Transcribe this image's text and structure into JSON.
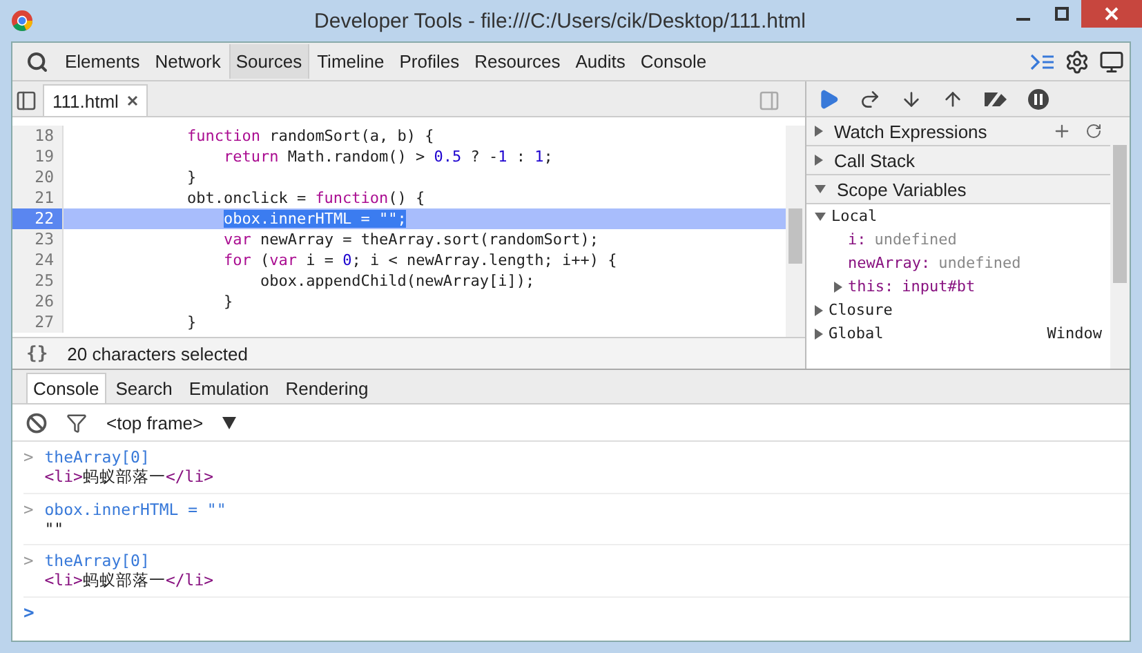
{
  "window": {
    "title": "Developer Tools - file:///C:/Users/cik/Desktop/111.html"
  },
  "panels": [
    {
      "label": "Elements",
      "selected": false
    },
    {
      "label": "Network",
      "selected": false
    },
    {
      "label": "Sources",
      "selected": true
    },
    {
      "label": "Timeline",
      "selected": false
    },
    {
      "label": "Profiles",
      "selected": false
    },
    {
      "label": "Resources",
      "selected": false
    },
    {
      "label": "Audits",
      "selected": false
    },
    {
      "label": "Console",
      "selected": false
    }
  ],
  "editor": {
    "file_tab": "111.html",
    "lines": [
      {
        "number": "18",
        "current": false,
        "tokens": [
          {
            "text": "            function",
            "kind": "keyword"
          },
          {
            "text": " randomSort(a, b) {",
            "kind": "plain"
          }
        ]
      },
      {
        "number": "19",
        "current": false,
        "tokens": [
          {
            "text": "                return",
            "kind": "keyword"
          },
          {
            "text": " Math.random() > ",
            "kind": "plain"
          },
          {
            "text": "0.5",
            "kind": "number"
          },
          {
            "text": " ? -",
            "kind": "plain"
          },
          {
            "text": "1",
            "kind": "number"
          },
          {
            "text": " : ",
            "kind": "plain"
          },
          {
            "text": "1",
            "kind": "number"
          },
          {
            "text": ";",
            "kind": "plain"
          }
        ]
      },
      {
        "number": "20",
        "current": false,
        "tokens": [
          {
            "text": "            }",
            "kind": "plain"
          }
        ]
      },
      {
        "number": "21",
        "current": false,
        "tokens": [
          {
            "text": "            obt.onclick = ",
            "kind": "plain"
          },
          {
            "text": "function",
            "kind": "keyword"
          },
          {
            "text": "() {",
            "kind": "plain"
          }
        ]
      },
      {
        "number": "22",
        "current": true,
        "tokens": [
          {
            "text": "                obox.innerHTML = \"\";",
            "kind": "selection"
          }
        ]
      },
      {
        "number": "23",
        "current": false,
        "tokens": [
          {
            "text": "                var",
            "kind": "keyword"
          },
          {
            "text": " newArray = theArray.sort(randomSort);",
            "kind": "plain"
          }
        ]
      },
      {
        "number": "24",
        "current": false,
        "tokens": [
          {
            "text": "                for",
            "kind": "keyword"
          },
          {
            "text": " (",
            "kind": "plain"
          },
          {
            "text": "var",
            "kind": "keyword"
          },
          {
            "text": " i = ",
            "kind": "plain"
          },
          {
            "text": "0",
            "kind": "number"
          },
          {
            "text": "; i < newArray.length; i++) {",
            "kind": "plain"
          }
        ]
      },
      {
        "number": "25",
        "current": false,
        "tokens": [
          {
            "text": "                    obox.appendChild(newArray[i]);",
            "kind": "plain"
          }
        ]
      },
      {
        "number": "26",
        "current": false,
        "tokens": [
          {
            "text": "                }",
            "kind": "plain"
          }
        ]
      },
      {
        "number": "27",
        "current": false,
        "tokens": [
          {
            "text": "            }",
            "kind": "plain"
          }
        ]
      }
    ],
    "status": "20 characters selected",
    "format_button": "{}"
  },
  "sidebar": {
    "sections": [
      {
        "label": "Watch Expressions",
        "expanded": false
      },
      {
        "label": "Call Stack",
        "expanded": false
      },
      {
        "label": "Scope Variables",
        "expanded": true
      }
    ],
    "scopes": [
      {
        "label": "Local",
        "expanded": true,
        "children": [
          {
            "name": "i",
            "separator": ":",
            "value": "undefined",
            "kind": "undefined",
            "expandable": false
          },
          {
            "name": "newArray",
            "separator": ":",
            "value": "undefined",
            "kind": "undefined",
            "expandable": false
          },
          {
            "name": "this",
            "separator": ":",
            "value": "input#bt",
            "kind": "object",
            "expandable": true
          }
        ]
      },
      {
        "label": "Closure",
        "expanded": false
      },
      {
        "label": "Global",
        "expanded": false,
        "value": "Window"
      }
    ]
  },
  "drawer": {
    "tabs": [
      {
        "label": "Console",
        "selected": true
      },
      {
        "label": "Search",
        "selected": false
      },
      {
        "label": "Emulation",
        "selected": false
      },
      {
        "label": "Rendering",
        "selected": false
      }
    ],
    "frame": "<top frame>",
    "entries": [
      {
        "marker": ">",
        "input": "theArray[0]",
        "output": [
          {
            "text": "<li>",
            "kind": "tag"
          },
          {
            "text": "蚂蚁部落一",
            "kind": "plain"
          },
          {
            "text": "</li>",
            "kind": "tag"
          }
        ]
      },
      {
        "marker": ">",
        "input": "obox.innerHTML = \"\"",
        "output": [
          {
            "text": "\"\"",
            "kind": "plain"
          }
        ]
      },
      {
        "marker": ">",
        "input": "theArray[0]",
        "output": [
          {
            "text": "<li>",
            "kind": "tag"
          },
          {
            "text": "蚂蚁部落一",
            "kind": "plain"
          },
          {
            "text": "</li>",
            "kind": "tag"
          }
        ]
      }
    ],
    "prompt": ">"
  }
}
